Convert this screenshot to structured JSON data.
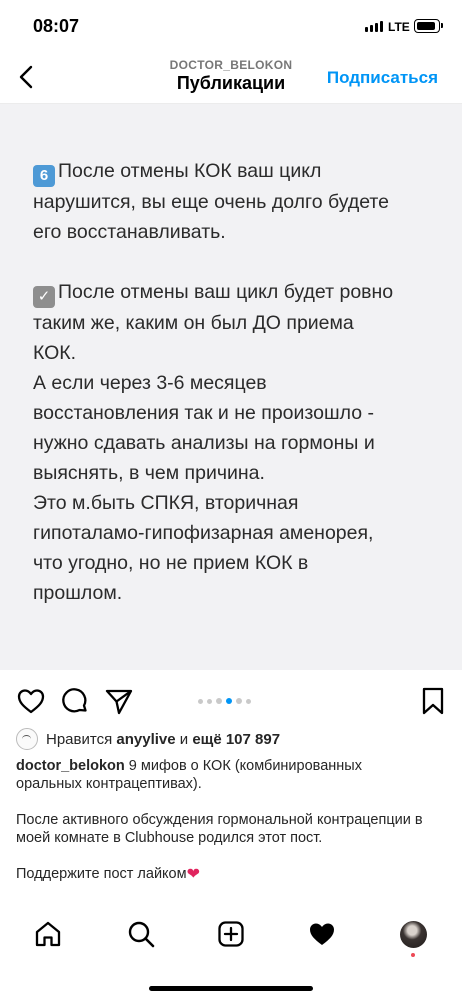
{
  "status_bar": {
    "time": "08:07",
    "network": "LTE"
  },
  "header": {
    "username": "DOCTOR_BELOKON",
    "title": "Публикации",
    "follow_label": "Подписаться"
  },
  "post": {
    "paragraphs": [
      {
        "emoji": "6",
        "text": "После отмены КОК ваш цикл\nнарушится, вы еще очень долго будете\nего восстанавливать."
      },
      {
        "emoji": "✓",
        "text": "После отмены ваш цикл будет ровно\nтаким же, каким он был ДО приема\nКОК.\nА если через 3-6 месяцев\nвосстановления  так и не произошло -\nнужно сдавать анализы на гормоны и\nвыяснять, в чем причина.\nЭто м.быть СПКЯ, вторичная\nгипоталамо-гипофизарная аменорея,\nчто угодно, но не прием КОК в\nпрошлом."
      }
    ],
    "carousel_active_index": 3
  },
  "likes": {
    "prefix": "Нравится",
    "liker": "anyylive",
    "conjunction": "и",
    "others": "ещё 107 897"
  },
  "caption": {
    "username": "doctor_belokon",
    "text": "9 мифов о КОК (комбинированных оральных контрацептивах).",
    "para2": "После активного обсуждения гормональной контрацепции в моей комнате в Clubhouse родился этот пост.",
    "para3": "Поддержите пост лайком",
    "para3_emoji": "❤"
  },
  "colors": {
    "accent": "#0095f6",
    "text": "#262626",
    "notification": "#ed4956"
  },
  "icons": [
    "back-icon",
    "heart-icon",
    "comment-icon",
    "share-icon",
    "bookmark-icon",
    "home-icon",
    "search-icon",
    "add-post-icon",
    "activity-heart-icon"
  ]
}
